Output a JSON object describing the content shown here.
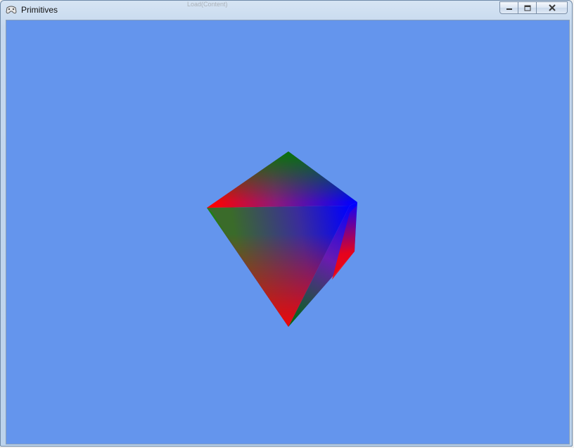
{
  "window": {
    "title": "Primitives",
    "background_text": "Load(Content)",
    "icon": "gamepad-icon",
    "caption_buttons": [
      "minimize-icon",
      "maximize-icon",
      "close-icon"
    ]
  },
  "viewport": {
    "clear_color": "#6495ed",
    "primitive": "octahedron",
    "vertex_colors": [
      "#ff0000",
      "#008000",
      "#0000ff"
    ]
  }
}
